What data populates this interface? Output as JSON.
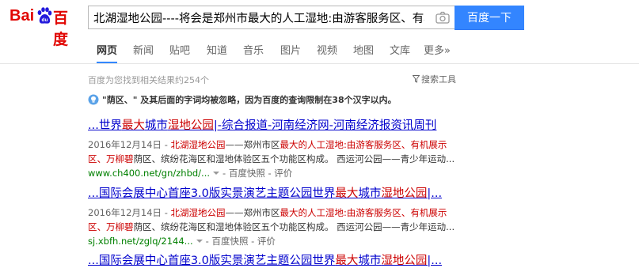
{
  "logo": {
    "text_en": "Bai",
    "text_cn": "百度"
  },
  "search": {
    "query": "北湖湿地公园----将会是郑州市最大的人工湿地:由游客服务区、有机展示",
    "button_label": "百度一下"
  },
  "nav": {
    "items": [
      "网页",
      "新闻",
      "贴吧",
      "知道",
      "音乐",
      "图片",
      "视频",
      "地图",
      "文库",
      "更多»"
    ],
    "active": "网页"
  },
  "stats": {
    "text": "百度为您找到相关结果约254个"
  },
  "tools": {
    "label": "搜索工具"
  },
  "notice": {
    "text": "\"荫区、\" 及其后面的字词均被忽略，因为百度的查询限制在38个汉字以内。"
  },
  "results": [
    {
      "title_parts": [
        "...世界",
        "最大",
        "城市",
        "湿地公园",
        "|-综合报道-河南经济网-河南经济报资讯周刊"
      ],
      "date": "2016年12月14日 - ",
      "abs_parts": [
        "北湖湿地公园",
        "——郑州市区",
        "最大的人工湿地:由游客服务区、有机展示区、",
        "万柳碧",
        "荫区、缤纷花海区和湿地体验区五个功能区构成。 西运河公园——青少年运动..."
      ],
      "url": "www.ch400.net/gn/zhbd/...",
      "snapshot": "百度快照",
      "evaluate": "评价"
    },
    {
      "title_parts": [
        "...国际会展中心首座3.0版实景演艺主题公园世界",
        "最大",
        "城市",
        "湿地公园",
        "|..."
      ],
      "date": "2016年12月14日 - ",
      "abs_parts": [
        "北湖湿地公园",
        "——郑州市区",
        "最大的人工湿地:由游客服务区、有机展示区、",
        "万柳碧",
        "荫区、缤纷花海区和湿地体验区五个功能区构成。 西运河公园——青少年运动..."
      ],
      "url": "sj.xbfh.net/zglq/2144...",
      "snapshot": "百度快照",
      "evaluate": "评价"
    },
    {
      "title_parts": [
        "...国际会展中心首座3.0版实景演艺主题公园世界",
        "最大",
        "城市",
        "湿地公园",
        "|..."
      ]
    }
  ],
  "colors": {
    "brand_red": "#e10602",
    "button_blue": "#3385ff",
    "link_blue": "#0000cc",
    "highlight_red": "#cc0000",
    "url_green": "#008000"
  },
  "icons": {
    "logo": "baidu-paw-icon",
    "camera": "camera-icon",
    "filter": "funnel-icon",
    "notice": "lightbulb-icon"
  }
}
